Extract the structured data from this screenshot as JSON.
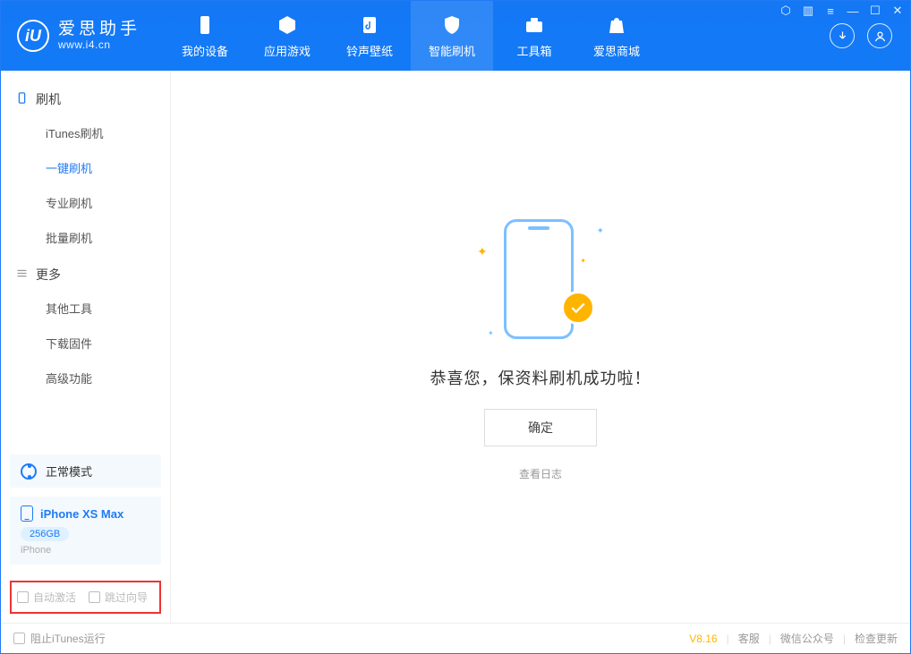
{
  "brand": {
    "name": "爱思助手",
    "domain": "www.i4.cn",
    "logo_letter": "iU"
  },
  "nav": {
    "items": [
      {
        "label": "我的设备",
        "icon": "phone"
      },
      {
        "label": "应用游戏",
        "icon": "cube"
      },
      {
        "label": "铃声壁纸",
        "icon": "music"
      },
      {
        "label": "智能刷机",
        "icon": "shield"
      },
      {
        "label": "工具箱",
        "icon": "toolbox"
      },
      {
        "label": "爱思商城",
        "icon": "bag"
      }
    ],
    "active_index": 3
  },
  "sidebar": {
    "groups": [
      {
        "title": "刷机",
        "items": [
          "iTunes刷机",
          "一键刷机",
          "专业刷机",
          "批量刷机"
        ],
        "selected_index": 1,
        "icon": "phone"
      },
      {
        "title": "更多",
        "items": [
          "其他工具",
          "下载固件",
          "高级功能"
        ],
        "selected_index": -1,
        "icon": "menu"
      }
    ],
    "status_label": "正常模式",
    "device": {
      "name": "iPhone XS Max",
      "storage": "256GB",
      "type": "iPhone"
    },
    "options": [
      {
        "label": "自动激活",
        "checked": false
      },
      {
        "label": "跳过向导",
        "checked": false
      }
    ]
  },
  "main": {
    "success_message": "恭喜您，保资料刷机成功啦！",
    "ok_button": "确定",
    "view_log": "查看日志"
  },
  "footer": {
    "block_itunes": "阻止iTunes运行",
    "version": "V8.16",
    "links": [
      "客服",
      "微信公众号",
      "检查更新"
    ]
  },
  "winctl": {
    "shirt": "⬡",
    "book": "▥",
    "menu": "≡",
    "min": "—",
    "max": "☐",
    "close": "✕"
  }
}
